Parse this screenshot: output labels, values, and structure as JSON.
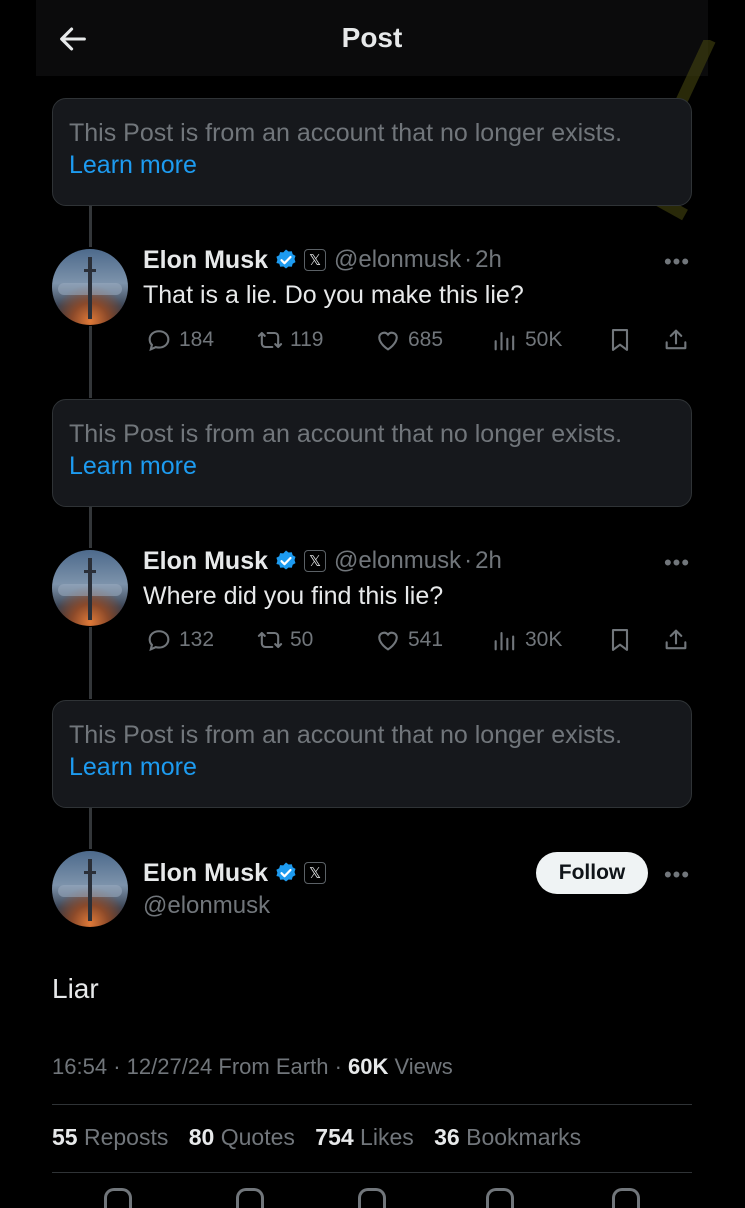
{
  "header": {
    "title": "Post",
    "back_icon": "arrow-left-icon"
  },
  "deleted_notice": {
    "message": "This Post is from an account that no longer exists.",
    "link": "Learn more"
  },
  "replies": [
    {
      "name": "Elon Musk",
      "handle": "@elonmusk",
      "time": "2h",
      "text": "That is a lie. Do you make this lie?",
      "replies": "184",
      "reposts": "119",
      "likes": "685",
      "views": "50K"
    },
    {
      "name": "Elon Musk",
      "handle": "@elonmusk",
      "time": "2h",
      "text": "Where did you find this lie?",
      "replies": "132",
      "reposts": "50",
      "likes": "541",
      "views": "30K"
    }
  ],
  "main_post": {
    "name": "Elon Musk",
    "handle": "@elonmusk",
    "follow_label": "Follow",
    "text": "Liar",
    "time": "16:54",
    "date": "12/27/24",
    "source": "From Earth",
    "views_count": "60K",
    "views_label": "Views",
    "stats": {
      "reposts_count": "55",
      "reposts_label": "Reposts",
      "quotes_count": "80",
      "quotes_label": "Quotes",
      "likes_count": "754",
      "likes_label": "Likes",
      "bookmarks_count": "36",
      "bookmarks_label": "Bookmarks"
    }
  },
  "colors": {
    "background": "#000000",
    "link": "#1d9bf0",
    "muted": "#71767b",
    "verified": "#1d9bf0",
    "card": "#16181c"
  },
  "x_badge": "𝕏",
  "separator": "·"
}
